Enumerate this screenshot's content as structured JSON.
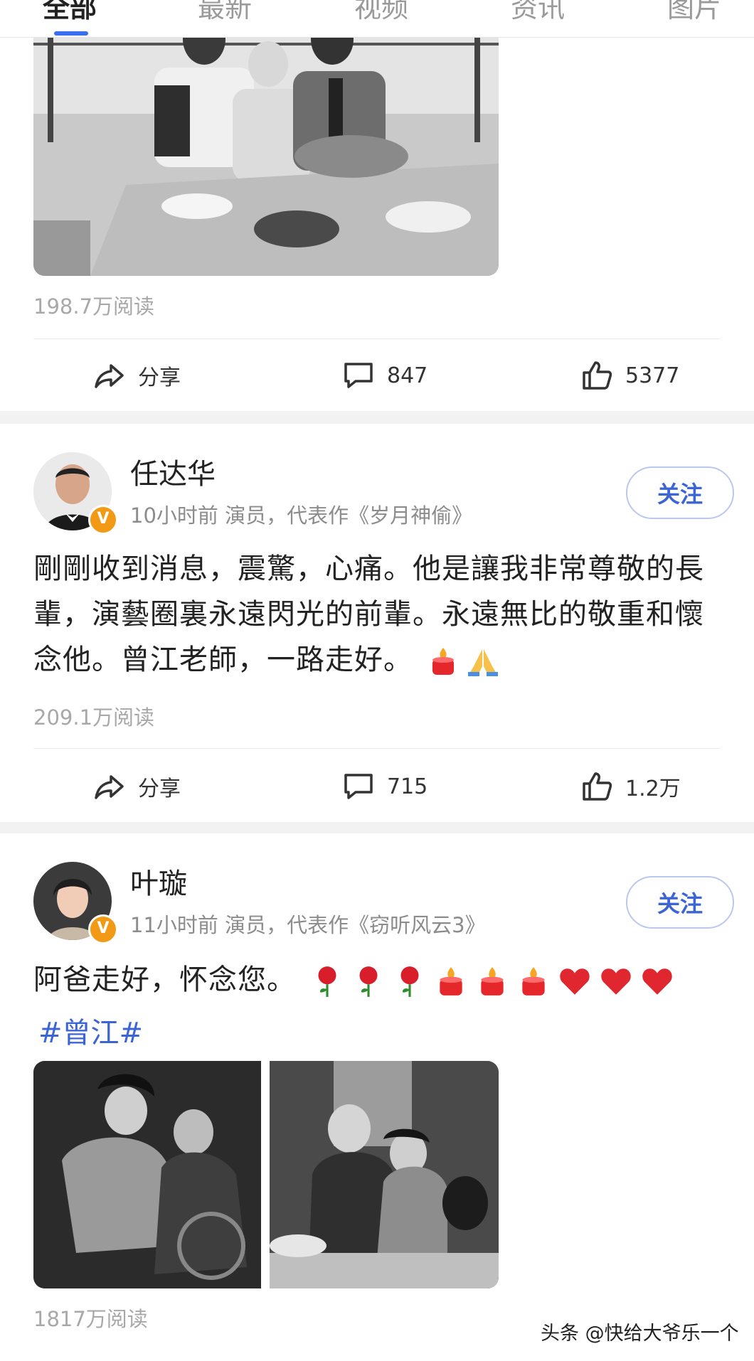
{
  "tabs": [
    "全部",
    "最新",
    "视频",
    "资讯",
    "图片"
  ],
  "posts": [
    {
      "reads": "198.7万阅读",
      "share_label": "分享",
      "comments": "847",
      "likes": "5377"
    },
    {
      "author": "任达华",
      "meta": "10小时前  演员，代表作《岁月神偷》",
      "follow_label": "关注",
      "text": "剛剛收到消息，震驚，心痛。他是讓我非常尊敬的長輩，演藝圈裏永遠閃光的前輩。永遠無比的敬重和懷念他。曾江老師，一路走好。",
      "emojis": [
        "candle",
        "pray"
      ],
      "reads": "209.1万阅读",
      "share_label": "分享",
      "comments": "715",
      "likes": "1.2万"
    },
    {
      "author": "叶璇",
      "meta": "11小时前  演员，代表作《窃听风云3》",
      "follow_label": "关注",
      "text": "阿爸走好，怀念您。",
      "emojis": [
        "rose",
        "rose",
        "rose",
        "candle",
        "candle",
        "candle",
        "heart",
        "heart",
        "heart"
      ],
      "hashtag": "#曾江#",
      "reads": "1817万阅读"
    }
  ],
  "badge_letter": "V",
  "watermark": "头条 @快给大爷乐一个",
  "colors": {
    "accent": "#3b65d4",
    "badge": "#f29a16",
    "muted": "#a8a8a8"
  }
}
